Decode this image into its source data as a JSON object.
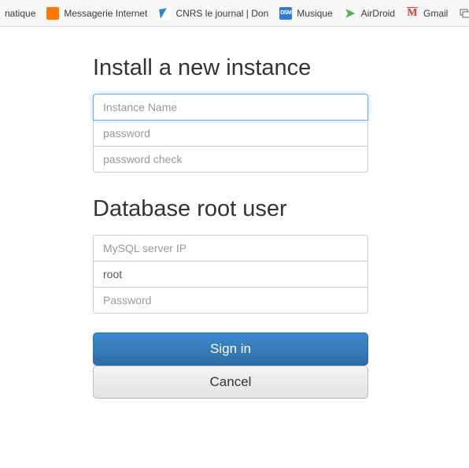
{
  "bookmarks": [
    {
      "label": "natique",
      "icon": ""
    },
    {
      "label": "Messagerie Internet",
      "icon": "orange"
    },
    {
      "label": "CNRS le journal | Don",
      "icon": "cnrs"
    },
    {
      "label": "Musique",
      "icon": "dsm",
      "icon_text": "DSM"
    },
    {
      "label": "AirDroid",
      "icon": "airdroid",
      "icon_text": "➤"
    },
    {
      "label": "Gmail",
      "icon": "gmail",
      "icon_text": "M"
    },
    {
      "label": "",
      "icon": "chevrons"
    }
  ],
  "section1": {
    "title": "Install a new instance",
    "instance_name": {
      "value": "",
      "placeholder": "Instance Name"
    },
    "password": {
      "value": "",
      "placeholder": "password"
    },
    "password_check": {
      "value": "",
      "placeholder": "password check"
    }
  },
  "section2": {
    "title": "Database root user",
    "mysql_ip": {
      "value": "",
      "placeholder": "MySQL server IP"
    },
    "root_user": {
      "value": "root",
      "placeholder": ""
    },
    "root_password": {
      "value": "",
      "placeholder": "Password"
    }
  },
  "buttons": {
    "signin": "Sign in",
    "cancel": "Cancel"
  }
}
